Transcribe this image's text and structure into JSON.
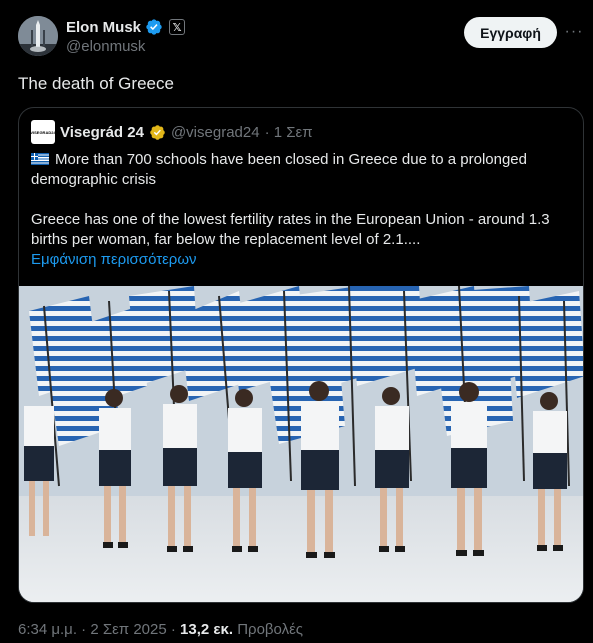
{
  "author": {
    "name": "Elon Musk",
    "handle": "@elonmusk",
    "avatar_icon": "rocket-launch-avatar",
    "verified_color": "#1d9bf0",
    "affiliation_badge": "𝕏"
  },
  "actions": {
    "follow_label": "Εγγραφή",
    "more_icon": "···"
  },
  "tweet": {
    "text": "The death of Greece"
  },
  "quote": {
    "name": "Visegrád 24",
    "handle": "@visegrad24",
    "time": "· 1 Σεπ",
    "verified_color": "#e2b719",
    "line1": "More than 700 schools have been closed in Greece due to a prolonged demographic crisis",
    "line2": "Greece has one of the lowest fertility rates in the European Union - around 1.3 births per woman, far below the replacement level of 2.1....",
    "show_more": "Εμφάνιση περισσότερων",
    "flag_icon": "greek-flag-emoji",
    "image_alt_subject": "parade-photo"
  },
  "footer": {
    "time": "6:34 μ.μ.",
    "sep": " · ",
    "date": "2 Σεπ 2025",
    "views": "13,2 εκ.",
    "views_label": "Προβολές"
  }
}
